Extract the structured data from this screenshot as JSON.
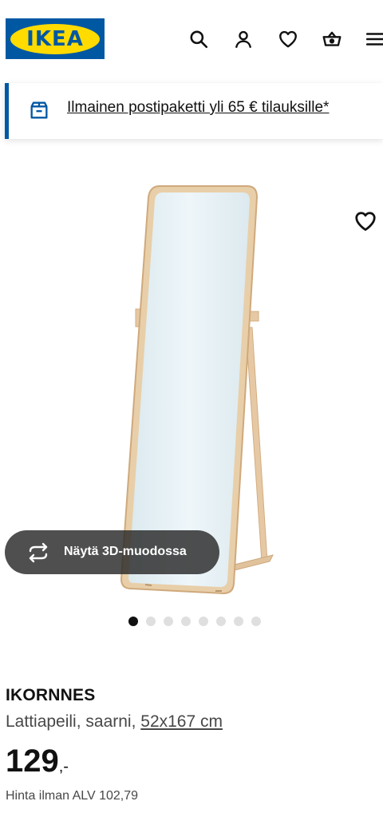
{
  "header": {
    "logo_text": "IKEA",
    "icons": [
      "search-icon",
      "user-icon",
      "heart-icon",
      "basket-icon",
      "menu-icon"
    ],
    "colors": {
      "brand_blue": "#0058a3",
      "brand_yellow": "#ffdb00"
    }
  },
  "banner": {
    "text": "Ilmainen postipaketti yli 65 € tilauksille*",
    "icon": "delivery-box-icon"
  },
  "gallery": {
    "view_3d_label": "Näytä 3D-muodossa",
    "dot_count": 8,
    "active_dot": 1
  },
  "product": {
    "name": "IKORNNES",
    "description": "Lattiapeili, saarni, ",
    "size": "52x167 cm",
    "price_whole": "129",
    "price_suffix": ",-",
    "vat_text": "Hinta ilman ALV 102,79"
  }
}
